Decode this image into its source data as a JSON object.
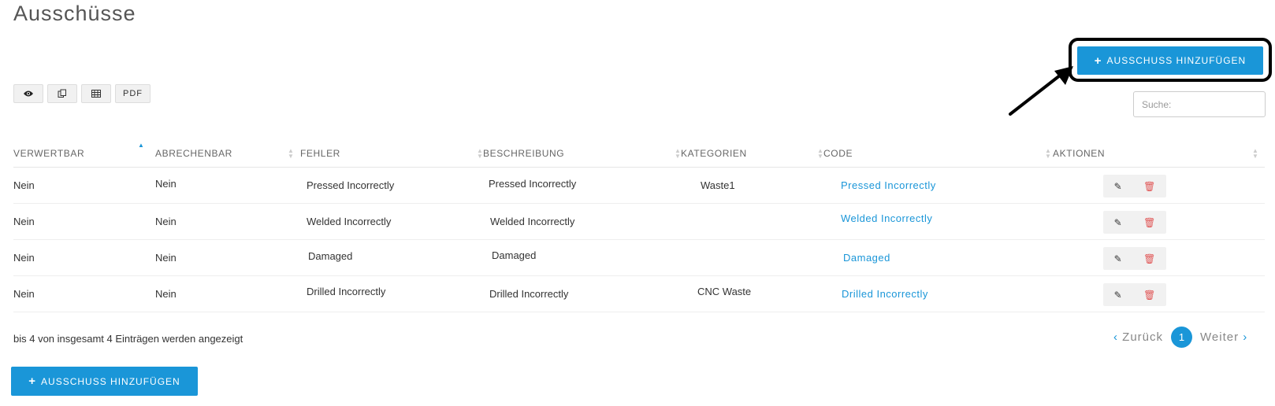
{
  "page": {
    "title": "Ausschüsse"
  },
  "actions": {
    "add_label": "AUSSCHUSS HINZUFÜGEN"
  },
  "toolbar": {
    "view_icon": "eye-icon",
    "copy_icon": "copy-icon",
    "excel_icon": "table-icon",
    "pdf_label": "PDF"
  },
  "search": {
    "placeholder": "Suche:"
  },
  "table": {
    "columns": [
      "VERWERTBAR",
      "ABRECHENBAR",
      "FEHLER",
      "BESCHREIBUNG",
      "KATEGORIEN",
      "CODE",
      "AKTIONEN"
    ],
    "rows": [
      [
        "Nein",
        "Nein",
        "Pressed Incorrectly",
        "Pressed Incorrectly",
        "Waste1",
        "Pressed Incorrectly"
      ],
      [
        "Nein",
        "Nein",
        "Welded Incorrectly",
        "Welded Incorrectly",
        "",
        "Welded Incorrectly"
      ],
      [
        "Nein",
        "Nein",
        "Damaged",
        "Damaged",
        "",
        "Damaged"
      ],
      [
        "Nein",
        "Nein",
        "Drilled Incorrectly",
        "Drilled Incorrectly",
        "CNC Waste",
        "Drilled Incorrectly"
      ]
    ]
  },
  "footer": {
    "info": "bis 4 von insgesamt 4 Einträgen werden angezeigt"
  },
  "pagination": {
    "prev": "Zurück",
    "current": "1",
    "next": "Weiter"
  },
  "colors": {
    "accent": "#1a96d8",
    "danger": "#e05555"
  }
}
